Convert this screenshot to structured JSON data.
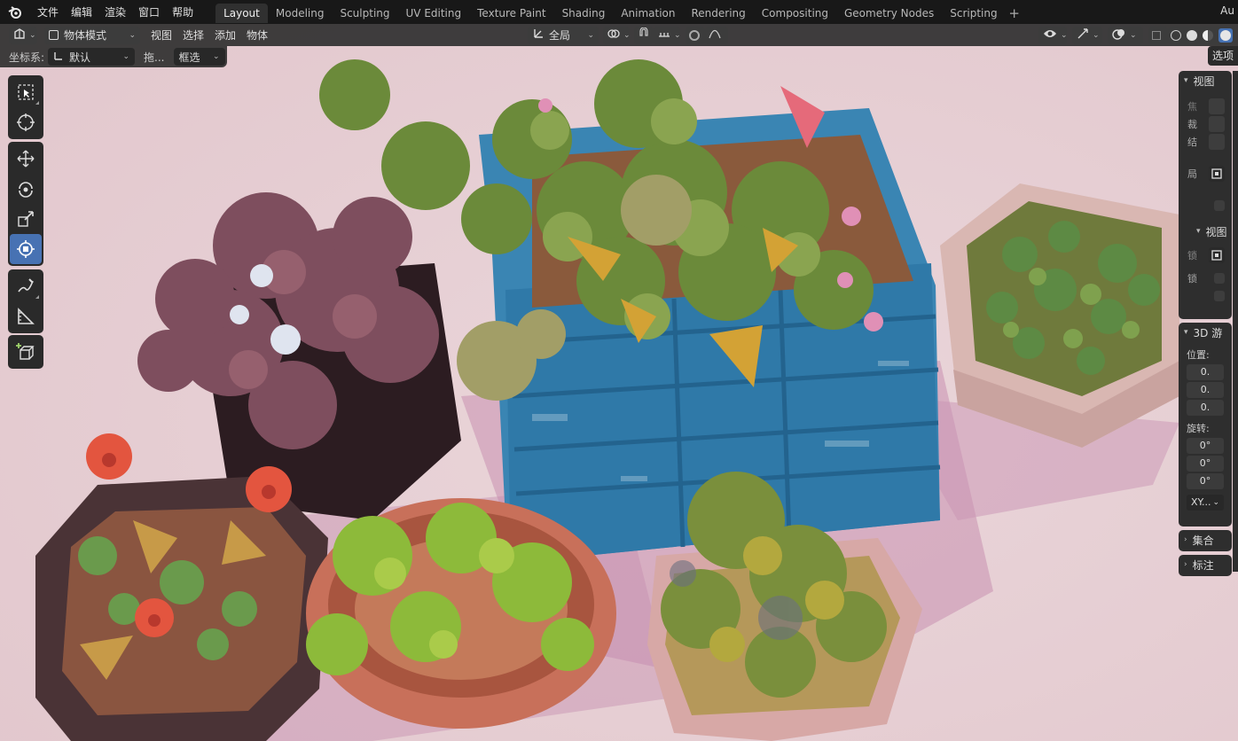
{
  "menubar": {
    "items": [
      "文件",
      "编辑",
      "渲染",
      "窗口",
      "帮助"
    ],
    "workspaces": [
      "Layout",
      "Modeling",
      "Sculpting",
      "UV Editing",
      "Texture Paint",
      "Shading",
      "Animation",
      "Rendering",
      "Compositing",
      "Geometry Nodes",
      "Scripting"
    ],
    "active_workspace": "Layout",
    "right_text": "Au"
  },
  "header": {
    "mode": "物体模式",
    "menus": [
      "视图",
      "选择",
      "添加",
      "物体"
    ],
    "transform_orientation": "全局"
  },
  "row2": {
    "coord_label": "坐标系:",
    "coord_value": "默认",
    "drag_label": "拖...",
    "select_mode": "框选"
  },
  "options_label": "选项",
  "npanel": {
    "view_title": "视图",
    "view_rows": [
      "焦",
      "裁",
      "结",
      "局"
    ],
    "view2_title": "视图",
    "view2_rows": [
      "锁",
      "锁"
    ],
    "cursor_title": "3D 游",
    "location_label": "位置:",
    "location": [
      "0.",
      "0.",
      "0."
    ],
    "rotation_label": "旋转:",
    "rotation": [
      "0°",
      "0°",
      "0°"
    ],
    "rotation_mode": "XY...",
    "collection_title": "集合",
    "annotation_title": "标注"
  },
  "colors": {
    "viewport_bg": "#e6cdd2",
    "accent": "#4772b3",
    "crate": "#3a85b3"
  }
}
